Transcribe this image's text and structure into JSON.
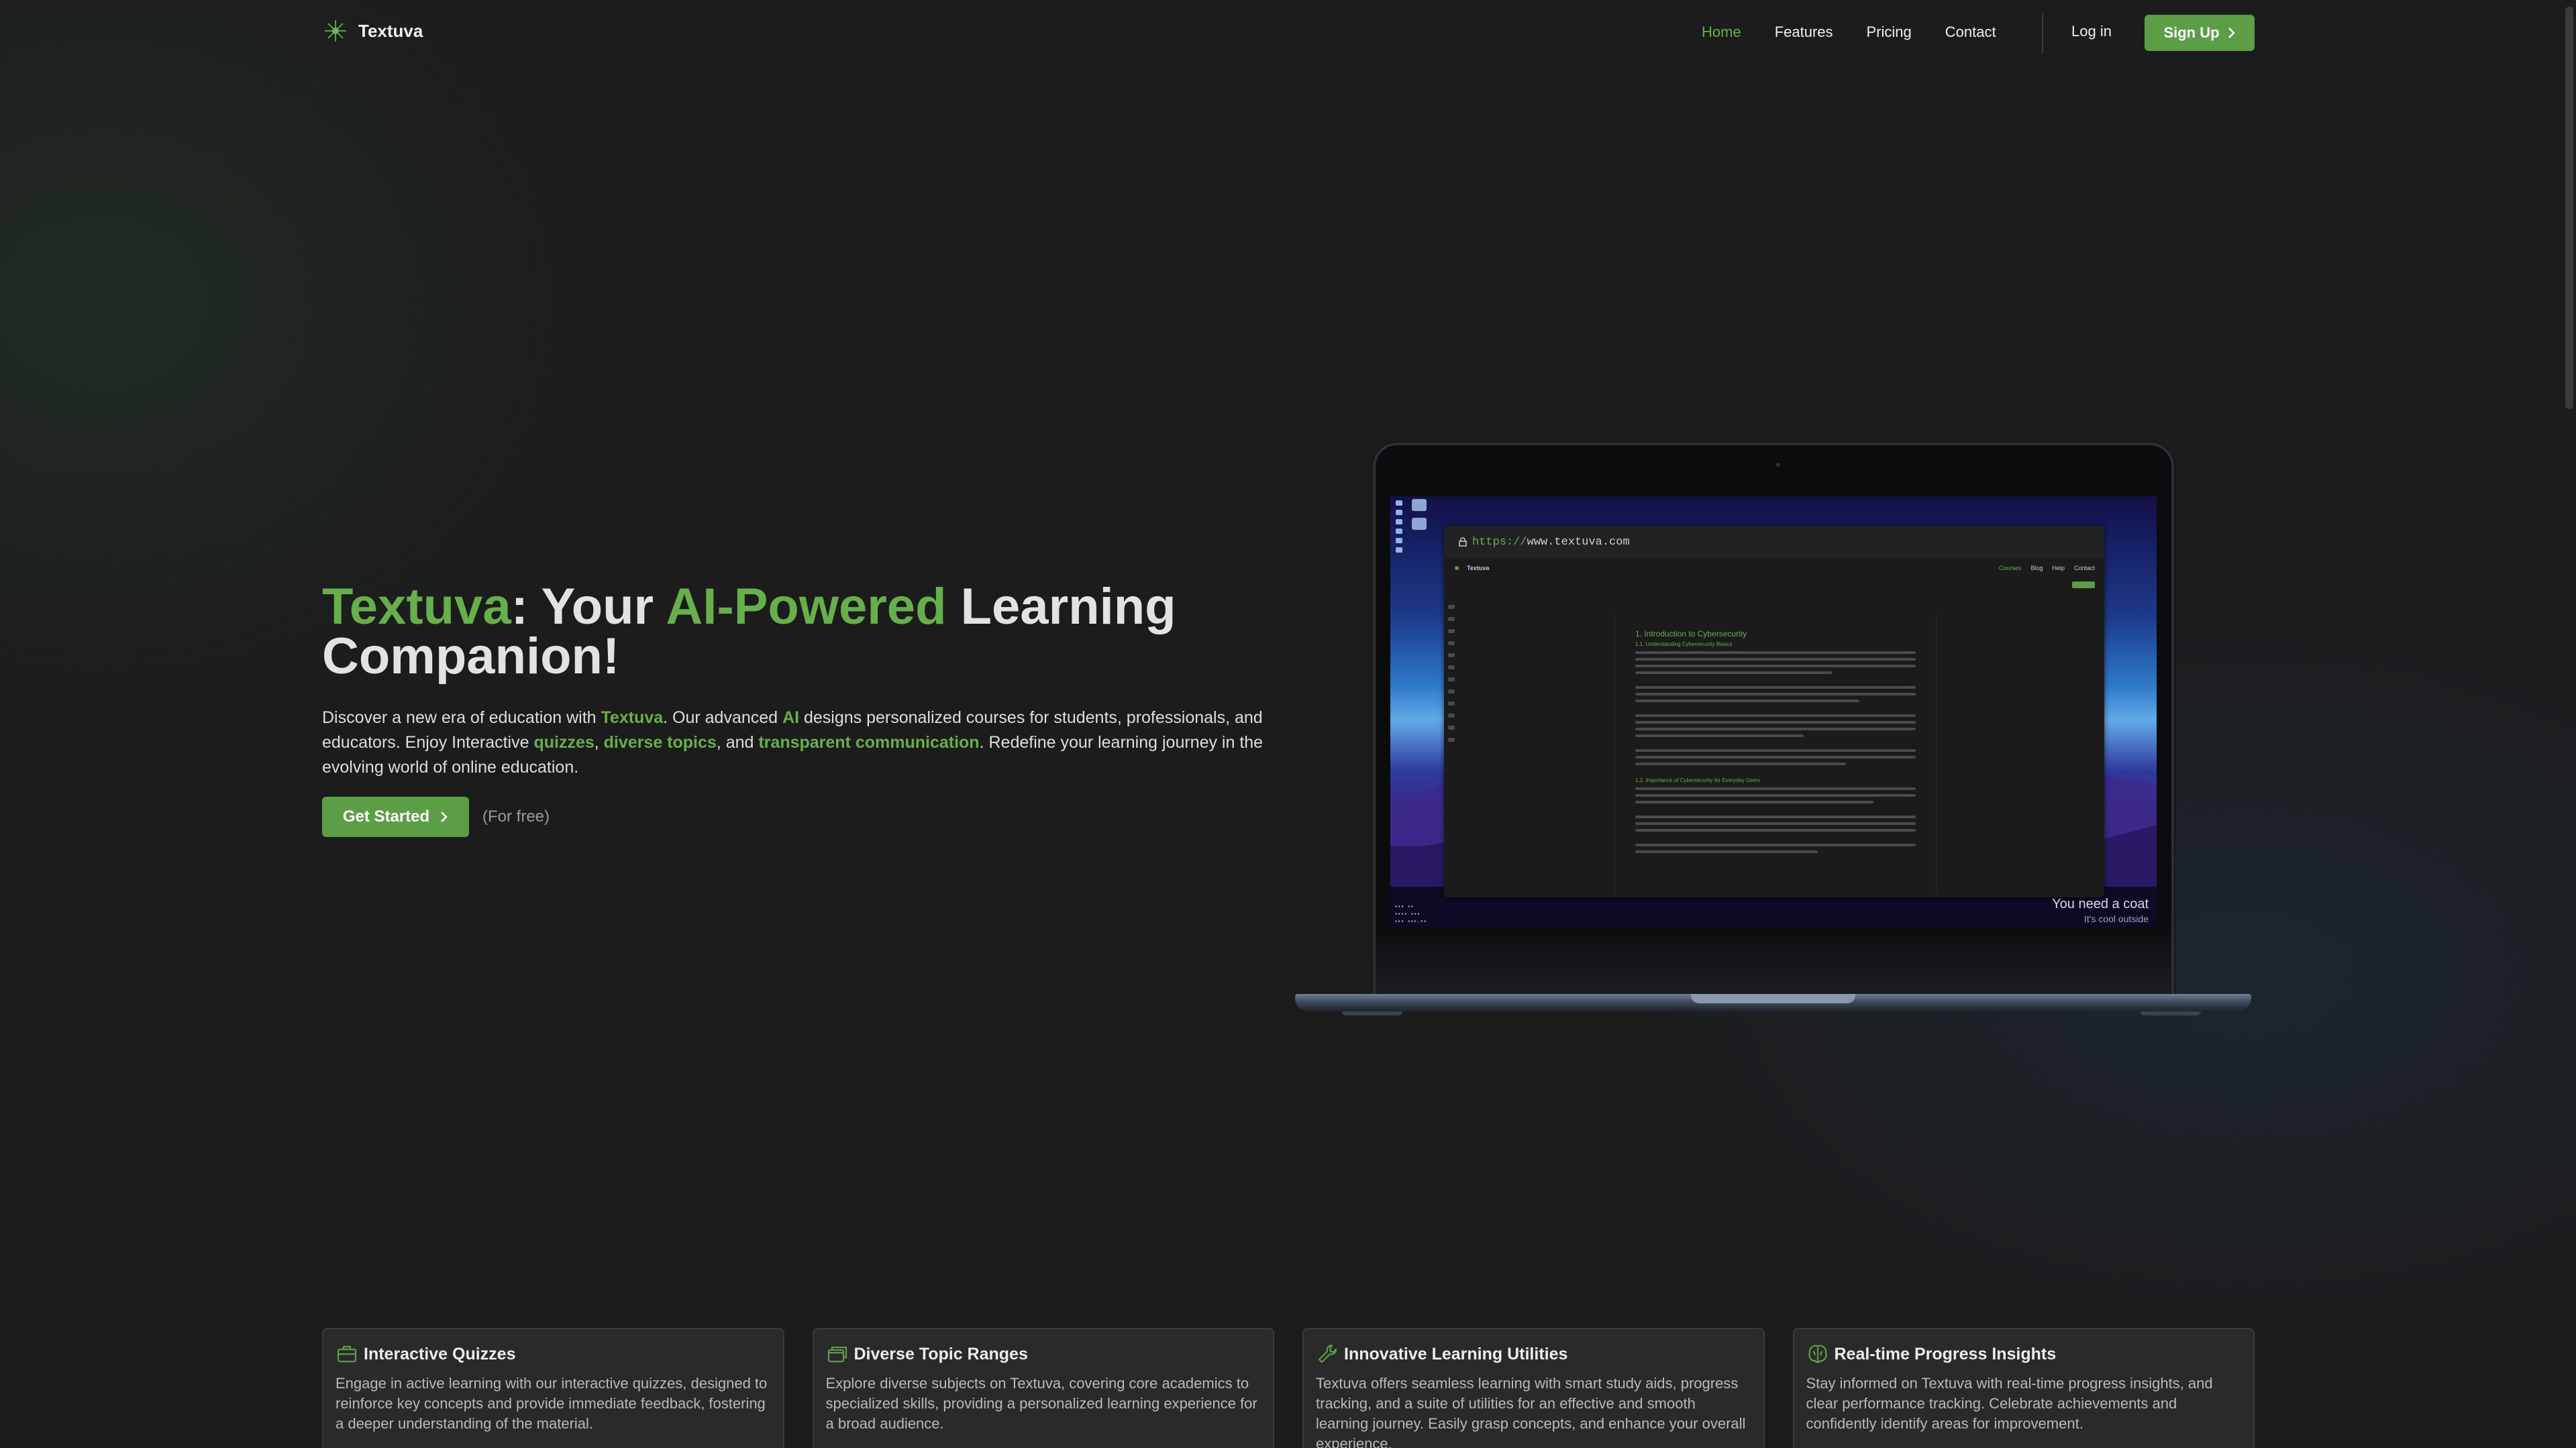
{
  "brand": {
    "name": "Textuva",
    "accent": "#5c9e45"
  },
  "nav": {
    "links": [
      {
        "label": "Home",
        "active": true
      },
      {
        "label": "Features",
        "active": false
      },
      {
        "label": "Pricing",
        "active": false
      },
      {
        "label": "Contact",
        "active": false
      }
    ],
    "login": "Log in",
    "signup": "Sign Up"
  },
  "hero": {
    "title_brand": "Textuva",
    "title_sep": ": Your ",
    "title_highlight": "AI-Powered",
    "title_rest": " Learning Companion!",
    "desc": {
      "p1": "Discover a new era of education with ",
      "brand": "Textuva",
      "p2": ". Our advanced ",
      "ai": "AI",
      "p3": " designs personalized courses for students, professionals, and educators. Enjoy Interactive ",
      "quizzes": "quizzes",
      "comma": ", ",
      "topics": "diverse topics",
      "and": ", and ",
      "comm": "transparent communication",
      "p4": ". Redefine your learning journey in the evolving world of online education."
    },
    "cta_label": "Get Started",
    "cta_note": "(For free)"
  },
  "laptop_screen": {
    "url_proto": "https://",
    "url_host": "www.textuva.com",
    "inner_brand": "Textuva",
    "inner_links": [
      "Courses",
      "Blog",
      "Help",
      "Contact"
    ],
    "doc_heading": "1. Introduction to Cybersecurity",
    "doc_sub1": "1.1. Understanding Cybersecurity Basics",
    "doc_sub2": "1.2. Importance of Cybersecurity for Everyday Users",
    "widget_line1": "You need a coat",
    "widget_line2": "It's cool outside"
  },
  "features": [
    {
      "icon": "quiz-box-icon",
      "title": "Interactive Quizzes",
      "text": "Engage in active learning with our interactive quizzes, designed to reinforce key concepts and provide immediate feedback, fostering a deeper understanding of the material."
    },
    {
      "icon": "windows-icon",
      "title": "Diverse Topic Ranges",
      "text": "Explore diverse subjects on Textuva, covering core academics to specialized skills, providing a personalized learning experience for a broad audience."
    },
    {
      "icon": "wrench-icon",
      "title": "Innovative Learning Utilities",
      "text": "Textuva offers seamless learning with smart study aids, progress tracking, and a suite of utilities for an effective and smooth learning journey. Easily grasp concepts, and enhance your overall experience."
    },
    {
      "icon": "brain-icon",
      "title": "Real-time Progress Insights",
      "text": "Stay informed on Textuva with real-time progress insights, and clear performance tracking. Celebrate achievements and confidently identify areas for improvement."
    }
  ]
}
